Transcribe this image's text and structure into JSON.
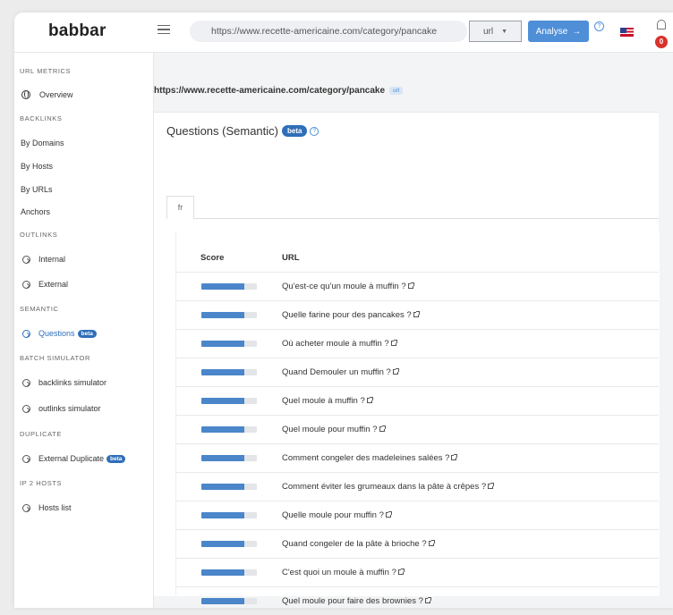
{
  "header": {
    "logo": "babbar",
    "url_value": "https://www.recette-americaine.com/category/pancake",
    "type_select": "url",
    "analyse_label": "Analyse",
    "help": "?",
    "notification_count": "0"
  },
  "sidebar": {
    "sections": [
      {
        "title": "URL METRICS"
      },
      {
        "title": "BACKLINKS"
      },
      {
        "title": "OUTLINKS"
      },
      {
        "title": "SEMANTIC"
      },
      {
        "title": "BATCH SIMULATOR"
      },
      {
        "title": "DUPLICATE"
      },
      {
        "title": "IP 2 HOSTS"
      }
    ],
    "items": [
      {
        "label": "Overview"
      },
      {
        "label": "By Domains"
      },
      {
        "label": "By Hosts"
      },
      {
        "label": "By URLs"
      },
      {
        "label": "Anchors"
      },
      {
        "label": "Internal"
      },
      {
        "label": "External"
      },
      {
        "label": "Questions",
        "badge": "beta"
      },
      {
        "label": "backlinks simulator"
      },
      {
        "label": "outlinks simulator"
      },
      {
        "label": "External Duplicate",
        "badge": "beta"
      },
      {
        "label": "Hosts list"
      }
    ]
  },
  "main": {
    "page_url": "https://www.recette-americaine.com/category/pancake",
    "page_url_tag": "url",
    "card_title": "Questions (Semantic)",
    "card_badge": "beta",
    "help": "?",
    "tab": "fr",
    "columns": {
      "score": "Score",
      "url": "URL"
    },
    "rows": [
      {
        "score": 0.78,
        "question": "Qu'est-ce qu'un moule à muffin ?"
      },
      {
        "score": 0.78,
        "question": "Quelle farine pour des pancakes ?"
      },
      {
        "score": 0.78,
        "question": "Où acheter moule à muffin ?"
      },
      {
        "score": 0.78,
        "question": "Quand Demouler un muffin ?"
      },
      {
        "score": 0.78,
        "question": "Quel moule à muffin ?"
      },
      {
        "score": 0.78,
        "question": "Quel moule pour muffin ?"
      },
      {
        "score": 0.78,
        "question": "Comment congeler des madeleines salées ?"
      },
      {
        "score": 0.78,
        "question": "Comment éviter les grumeaux dans la pâte à crêpes ?"
      },
      {
        "score": 0.78,
        "question": "Quelle moule pour muffin ?"
      },
      {
        "score": 0.78,
        "question": "Quand congeler de la pâte à brioche ?"
      },
      {
        "score": 0.78,
        "question": "C'est quoi un moule à muffin ?"
      },
      {
        "score": 0.78,
        "question": "Quel moule pour faire des brownies ?"
      }
    ]
  },
  "colors": {
    "accent": "#4f8fd8",
    "score_fill": "#4a86c9",
    "badge": "#2f6fb8",
    "notification": "#d9312b"
  }
}
